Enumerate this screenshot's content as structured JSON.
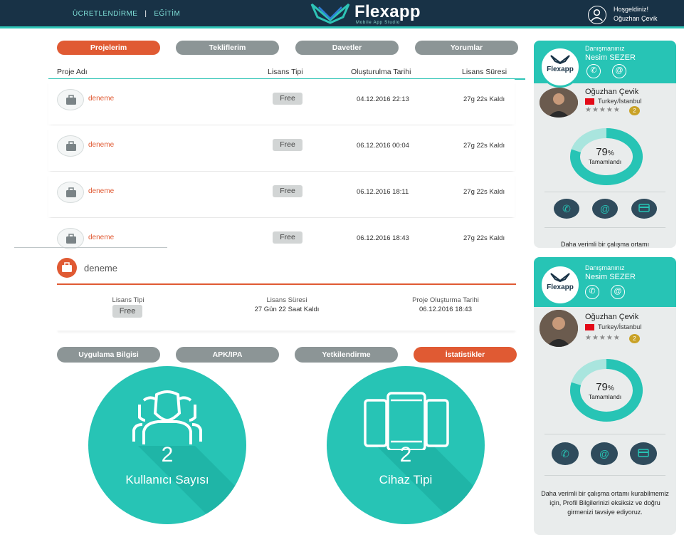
{
  "topbar": {
    "nav": [
      "ÜCRETLENDİRME",
      "EĞİTİM"
    ],
    "separator": "|",
    "logo_text": "Flexapp",
    "logo_sub": "Mobile App Studio",
    "greeting": "Hoşgeldiniz!",
    "username": "Oğuzhan Çevik"
  },
  "tabs": [
    {
      "label": "Projelerim",
      "active": true
    },
    {
      "label": "Tekliflerim",
      "active": false
    },
    {
      "label": "Davetler",
      "active": false
    },
    {
      "label": "Yorumlar",
      "active": false
    }
  ],
  "table": {
    "headers": [
      "Proje Adı",
      "Lisans Tipi",
      "Oluşturulma Tarihi",
      "Lisans Süresi"
    ],
    "rows": [
      {
        "name": "deneme",
        "license": "Free",
        "created": "04.12.2016 22:13",
        "remaining": "27g 22s Kaldı"
      },
      {
        "name": "deneme",
        "license": "Free",
        "created": "06.12.2016 00:04",
        "remaining": "27g 22s Kaldı"
      },
      {
        "name": "deneme",
        "license": "Free",
        "created": "06.12.2016 18:11",
        "remaining": "27g 22s Kaldı"
      },
      {
        "name": "deneme",
        "license": "Free",
        "created": "06.12.2016 18:43",
        "remaining": "27g 22s Kaldı"
      }
    ]
  },
  "detail": {
    "name": "deneme",
    "license_label": "Lisans Tipi",
    "license_value": "Free",
    "duration_label": "Lisans Süresi",
    "duration_value": "27 Gün 22 Saat Kaldı",
    "created_label": "Proje Oluşturma Tarihi",
    "created_value": "06.12.2016 18:43"
  },
  "subtabs": [
    {
      "label": "Uygulama Bilgisi",
      "active": false
    },
    {
      "label": "APK/IPA",
      "active": false
    },
    {
      "label": "Yetkilendirme",
      "active": false
    },
    {
      "label": "İstatistikler",
      "active": true
    }
  ],
  "stats": [
    {
      "value": "2",
      "label": "Kullanıcı Sayısı",
      "icon": "users-icon"
    },
    {
      "value": "2",
      "label": "Cihaz Tipi",
      "icon": "devices-icon"
    }
  ],
  "advisor_card": {
    "logo": "Flexapp",
    "advisor_label": "Danışmanınız",
    "advisor_name": "Nesim SEZER",
    "user_name": "Oğuzhan Çevik",
    "location": "Turkey/İstanbul",
    "stars": "★★★★★",
    "level": "2",
    "percent": "79",
    "percent_sign": "%",
    "percent_fraction": 0.79,
    "completed_label": "Tamamlandı",
    "message_short": "Daha verimli bir çalışma ortamı",
    "message_full": "Daha verimli bir çalışma ortamı kurabilmemiz için, Profil Bilgilerinizi eksiksiz ve doğru girmenizi tavsiye ediyoruz.",
    "accent": "#27c4b5"
  },
  "colors": {
    "primary": "#e05a33",
    "teal": "#2ec4b6",
    "header": "#183246",
    "inactive": "#8c9596"
  }
}
